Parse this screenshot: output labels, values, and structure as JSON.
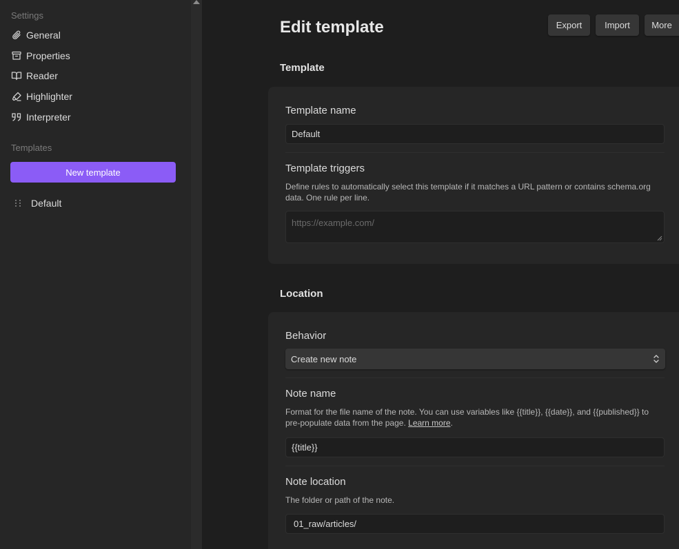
{
  "sidebar": {
    "settings_label": "Settings",
    "items": [
      {
        "label": "General",
        "icon": "paperclip-icon"
      },
      {
        "label": "Properties",
        "icon": "archive-icon"
      },
      {
        "label": "Reader",
        "icon": "book-open-icon"
      },
      {
        "label": "Highlighter",
        "icon": "highlighter-icon"
      },
      {
        "label": "Interpreter",
        "icon": "quote-icon"
      }
    ],
    "templates_label": "Templates",
    "new_template_label": "New template",
    "templates": [
      {
        "label": "Default"
      }
    ]
  },
  "header": {
    "title": "Edit template",
    "export_label": "Export",
    "import_label": "Import",
    "more_label": "More"
  },
  "template_section": {
    "heading": "Template",
    "name_label": "Template name",
    "name_value": "Default",
    "triggers_label": "Template triggers",
    "triggers_desc": "Define rules to automatically select this template if it matches a URL pattern or contains schema.org data. One rule per line.",
    "triggers_placeholder": "https://example.com/"
  },
  "location_section": {
    "heading": "Location",
    "behavior_label": "Behavior",
    "behavior_value": "Create new note",
    "note_name_label": "Note name",
    "note_name_desc": "Format for the file name of the note. You can use variables like {{title}}, {{date}}, and {{published}} to pre-populate data from the page.",
    "note_name_link": "Learn more",
    "note_name_value": "{{title}}",
    "note_location_label": "Note location",
    "note_location_desc": "The folder or path of the note.",
    "note_location_value": "01_raw/articles/"
  },
  "colors": {
    "accent": "#8b5cf6",
    "background": "#1e1e1e",
    "sidebar": "#262626"
  }
}
